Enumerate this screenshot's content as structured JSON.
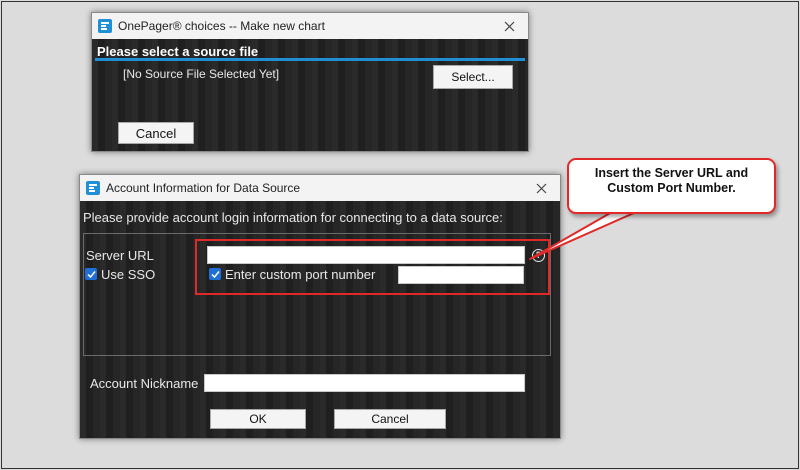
{
  "colors": {
    "accent_blue": "#1f8fd6",
    "checkbox_blue": "#1f6fd6",
    "highlight_red": "#e02a2a",
    "dialog_bg": "#242424",
    "titlebar_bg": "#f3f3f3"
  },
  "source_dialog": {
    "title": "OnePager® choices -- Make new chart",
    "heading": "Please select a source file",
    "status": "[No Source File Selected Yet]",
    "select_label": "Select...",
    "cancel_label": "Cancel",
    "icon": "app-logo-icon"
  },
  "account_dialog": {
    "title": "Account Information for Data Source",
    "instructions": "Please provide account login information for connecting to a data source:",
    "server_url_label": "Server URL",
    "server_url_value": "",
    "use_sso_label": "Use SSO",
    "use_sso_checked": true,
    "custom_port_label": "Enter custom port number",
    "custom_port_checked": true,
    "custom_port_value": "",
    "nickname_label": "Account Nickname",
    "nickname_value": "",
    "ok_label": "OK",
    "cancel_label": "Cancel",
    "icon": "app-logo-icon"
  },
  "callout": {
    "text": "Insert the Server URL and Custom Port Number."
  }
}
